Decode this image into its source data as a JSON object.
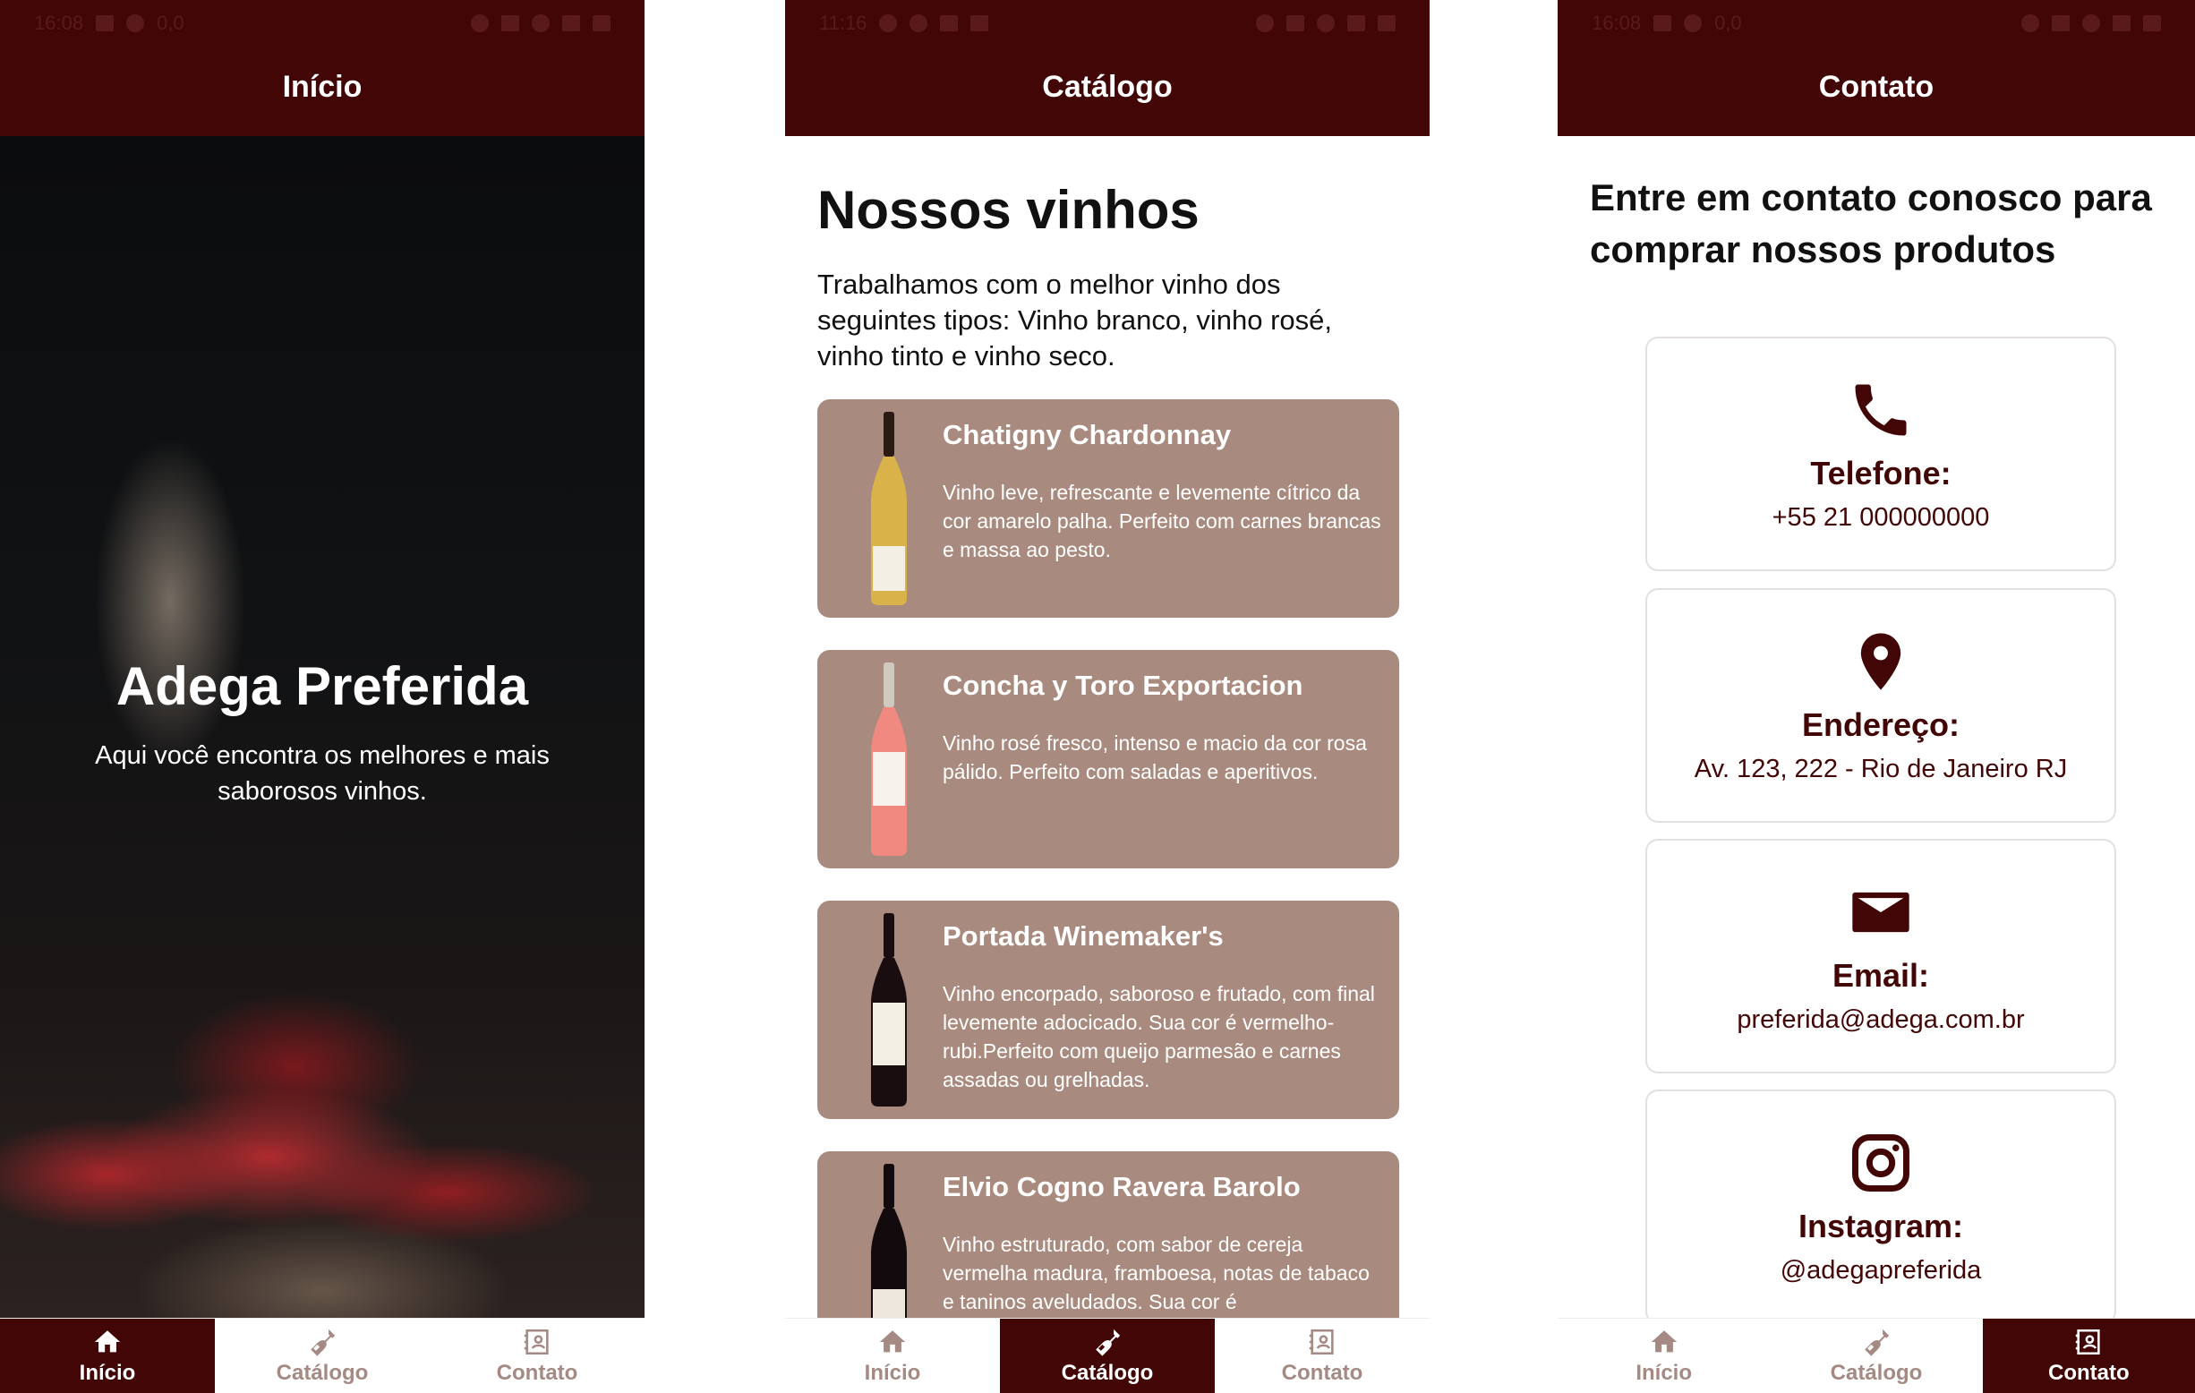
{
  "screens": {
    "inicio": {
      "appbar_title": "Início",
      "hero": {
        "title": "Adega Preferida",
        "subtitle": "Aqui você encontra os melhores e mais saborosos vinhos."
      }
    },
    "catalogo": {
      "appbar_title": "Catálogo",
      "heading": "Nossos vinhos",
      "intro": "Trabalhamos com o melhor vinho dos seguintes tipos: Vinho branco, vinho rosé, vinho tinto e vinho seco.",
      "wines": [
        {
          "name": "Chatigny Chardonnay",
          "description": "Vinho leve, refrescante e levemente cítrico da cor amarelo palha. Perfeito com carnes brancas e massa ao pesto.",
          "bottle_color": "#d9b24a"
        },
        {
          "name": "Concha y Toro Exportacion",
          "description": "Vinho rosé fresco, intenso e macio da cor rosa pálido. Perfeito com saladas e aperitivos.",
          "bottle_color": "#f08a80"
        },
        {
          "name": "Portada Winemaker's",
          "description": "Vinho encorpado, saboroso e frutado, com final levemente adocicado. Sua cor é vermelho-rubi.Perfeito com queijo parmesão e carnes assadas ou grelhadas.",
          "bottle_color": "#1a0d10"
        },
        {
          "name": "Elvio Cogno Ravera Barolo",
          "description": "Vinho estruturado, com sabor de cereja vermelha madura, framboesa, notas de tabaco e taninos aveludados. Sua cor é",
          "bottle_color": "#120a0c"
        }
      ]
    },
    "contato": {
      "appbar_title": "Contato",
      "heading": "Entre em contato conosco para comprar nossos produtos",
      "cards": [
        {
          "icon": "phone-icon",
          "label": "Telefone:",
          "value": "+55 21 000000000"
        },
        {
          "icon": "location-pin-icon",
          "label": "Endereço:",
          "value": "Av. 123, 222 - Rio de Janeiro RJ"
        },
        {
          "icon": "envelope-icon",
          "label": "Email:",
          "value": "preferida@adega.com.br"
        },
        {
          "icon": "instagram-icon",
          "label": "Instagram:",
          "value": "@adegapreferida"
        }
      ]
    }
  },
  "nav": {
    "items": [
      {
        "label": "Início",
        "icon": "home-icon"
      },
      {
        "label": "Catálogo",
        "icon": "wine-bottle-icon"
      },
      {
        "label": "Contato",
        "icon": "contact-card-icon"
      }
    ]
  },
  "status_bar": {
    "time_1": "16:08",
    "time_2": "11:16",
    "time_3": "16:08",
    "signal_text": "0,0"
  },
  "colors": {
    "primary": "#430607",
    "card_bg": "#a98a7f",
    "nav_inactive": "#a58a84"
  }
}
